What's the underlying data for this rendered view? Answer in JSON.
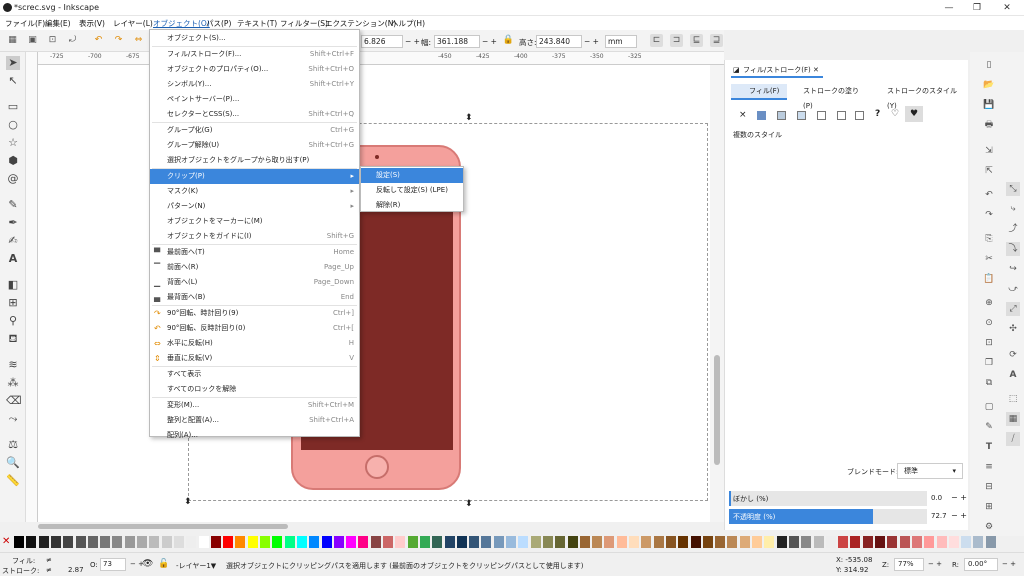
{
  "window": {
    "title": "*screc.svg - Inkscape"
  },
  "menubar": [
    "ファイル(F)",
    "編集(E)",
    "表示(V)",
    "レイヤー(L)",
    "オブジェクト(O)",
    "パス(P)",
    "テキスト(T)",
    "フィルター(S)",
    "エクステンション(N)",
    "ヘルプ(H)"
  ],
  "toolbar": {
    "x_value": "6.826",
    "w_label": "幅:",
    "w_value": "361.188",
    "h_label": "高さ:",
    "h_value": "243.840",
    "unit": "mm"
  },
  "ruler": [
    "-725",
    "-700",
    "-675",
    "-450",
    "-425",
    "-400",
    "-375",
    "-350",
    "-325"
  ],
  "object_menu": [
    {
      "label": "オブジェクト(S)...",
      "shortcut": ""
    },
    {
      "label": "フィル/ストローク(F)...",
      "shortcut": "Shift+Ctrl+F"
    },
    {
      "label": "オブジェクトのプロパティ(O)...",
      "shortcut": "Shift+Ctrl+O"
    },
    {
      "label": "シンボル(Y)...",
      "shortcut": "Shift+Ctrl+Y"
    },
    {
      "label": "ペイントサーバー(P)...",
      "shortcut": ""
    },
    {
      "label": "セレクターとCSS(S)...",
      "shortcut": "Shift+Ctrl+Q"
    },
    {
      "label": "グループ化(G)",
      "shortcut": "Ctrl+G"
    },
    {
      "label": "グループ解除(U)",
      "shortcut": "Shift+Ctrl+G"
    },
    {
      "label": "選択オブジェクトをグループから取り出す(P)",
      "shortcut": ""
    },
    {
      "label": "クリップ(P)",
      "shortcut": "▸"
    },
    {
      "label": "マスク(K)",
      "shortcut": "▸"
    },
    {
      "label": "パターン(N)",
      "shortcut": "▸"
    },
    {
      "label": "オブジェクトをマーカーに(M)",
      "shortcut": ""
    },
    {
      "label": "オブジェクトをガイドに(I)",
      "shortcut": "Shift+G"
    },
    {
      "label": "最前面へ(T)",
      "shortcut": "Home"
    },
    {
      "label": "前面へ(R)",
      "shortcut": "Page_Up"
    },
    {
      "label": "背面へ(L)",
      "shortcut": "Page_Down"
    },
    {
      "label": "最背面へ(B)",
      "shortcut": "End"
    },
    {
      "label": "90°回転、時計回り(9)",
      "shortcut": "Ctrl+]"
    },
    {
      "label": "90°回転、反時計回り(0)",
      "shortcut": "Ctrl+["
    },
    {
      "label": "水平に反転(H)",
      "shortcut": "H"
    },
    {
      "label": "垂直に反転(V)",
      "shortcut": "V"
    },
    {
      "label": "すべて表示",
      "shortcut": ""
    },
    {
      "label": "すべてのロックを解除",
      "shortcut": ""
    },
    {
      "label": "変形(M)...",
      "shortcut": "Shift+Ctrl+M"
    },
    {
      "label": "整列と配置(A)...",
      "shortcut": "Shift+Ctrl+A"
    },
    {
      "label": "配列(A)...",
      "shortcut": ""
    }
  ],
  "clip_submenu": [
    "設定(S)",
    "反転して設定(S) (LPE)",
    "解除(R)"
  ],
  "panel": {
    "tab": "フィル/ストローク(F)",
    "subtabs": [
      "フィル(F)",
      "ストロークの塗り(P)",
      "ストロークのスタイル(Y)"
    ],
    "multi_style": "複数のスタイル",
    "blend_label": "ブレンドモード:",
    "blend_value": "標準",
    "blur_label": "ぼかし (%)",
    "blur_value": "0.0",
    "opacity_label": "不透明度 (%)",
    "opacity_value": "72.7",
    "opacity_fraction": 0.727
  },
  "status": {
    "fill_label": "フィル:",
    "stroke_label": "ストローク:",
    "stroke_value": "2.87",
    "o_label": "O:",
    "o_value": "73",
    "layer": "-レイヤー1▼",
    "message": "選択オブジェクトにクリッピングパスを適用します (最前面のオブジェクトをクリッピングパスとして使用します)",
    "x": "X: -535.08",
    "y": "Y: 314.92",
    "z_label": "Z:",
    "zoom": "77%",
    "r_label": "R:",
    "rotation": "0.00°"
  },
  "colors": {
    "accent": "#3b86dc",
    "phone_body": "#f4a09c",
    "phone_screen": "#7e2a26"
  }
}
